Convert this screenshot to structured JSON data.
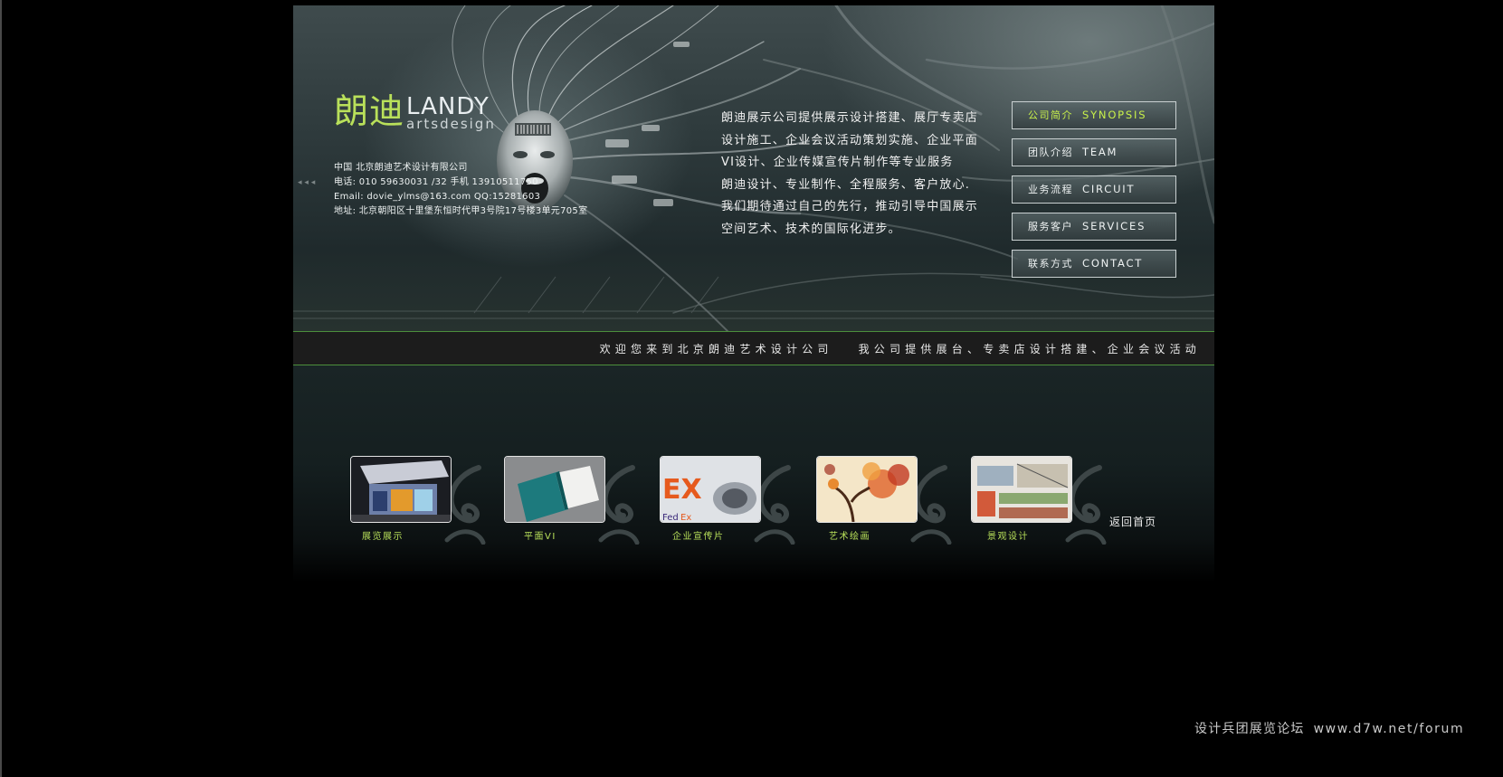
{
  "brand": {
    "name_cn": "朗迪",
    "name_en": "LANDY",
    "tagline": "artsdesign",
    "accent_color": "#b9e05a"
  },
  "contact": {
    "company": "中国   北京朗迪艺术设计有限公司",
    "phone": "电话:  010  59630031 /32    手机  13910511750",
    "email": "Email:  dovie_ylms@163.com     QQ:15281603",
    "address": "地址:   北京朝阳区十里堡东恒时代甲3号院17号楼3单元705室"
  },
  "intro": {
    "paragraph1": "朗迪展示公司提供展示设计搭建、展厅专卖店设计施工、企业会议活动策划实施、企业平面VI设计、企业传媒宣传片制作等专业服务",
    "paragraph2": "朗迪设计、专业制作、全程服务、客户放心.我们期待通过自己的先行，推动引导中国展示空间艺术、技术的国际化进步。"
  },
  "nav": {
    "items": [
      {
        "cn": "公司简介",
        "en": "SYNOPSIS"
      },
      {
        "cn": "团队介绍",
        "en": "TEAM"
      },
      {
        "cn": "业务流程",
        "en": "CIRCUIT"
      },
      {
        "cn": "服务客户",
        "en": "SERVICES"
      },
      {
        "cn": "联系方式",
        "en": "CONTACT"
      }
    ]
  },
  "ticker": {
    "welcome": "欢迎您来到北京朗迪艺术设计公司",
    "services": "我公司提供展台、专卖店设计搭建、企业会议活动"
  },
  "gallery": {
    "items": [
      {
        "label": "展览展示",
        "icon": "exhibition-booth-thumbnail"
      },
      {
        "label": "平面VI",
        "icon": "brochure-thumbnail"
      },
      {
        "label": "企业宣传片",
        "icon": "fedex-plane-thumbnail"
      },
      {
        "label": "艺术绘画",
        "icon": "tree-painting-thumbnail"
      },
      {
        "label": "景观设计",
        "icon": "landscape-plan-thumbnail"
      }
    ],
    "home_link": "返回首页"
  },
  "watermark": {
    "site": "设计兵团展览论坛",
    "url": "www.d7w.net/forum"
  }
}
